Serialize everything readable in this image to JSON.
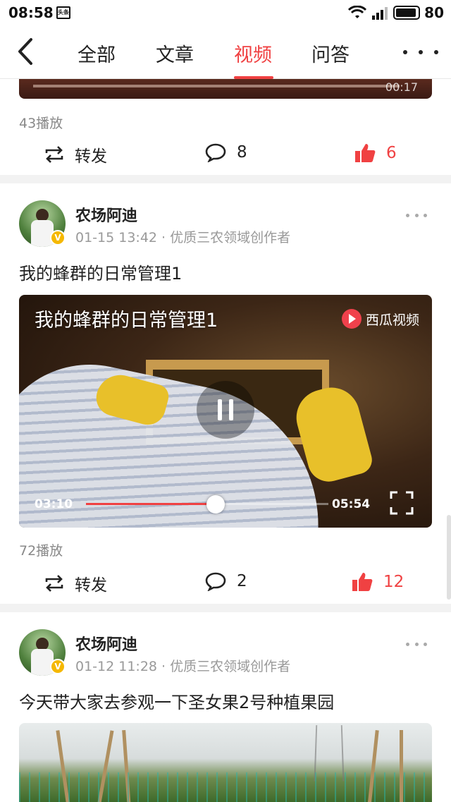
{
  "status_bar": {
    "time": "08:58",
    "notification_icon": "头条",
    "battery": "80"
  },
  "nav": {
    "tabs": [
      "全部",
      "文章",
      "视频",
      "问答"
    ],
    "active_tab": "视频"
  },
  "top_item": {
    "duration": "00:17",
    "plays": "43播放",
    "share_label": "转发",
    "comments": "8",
    "likes": "6"
  },
  "posts": [
    {
      "author": "农场阿迪",
      "meta": "01-15 13:42 · 优质三农领域创作者",
      "title": "我的蜂群的日常管理1",
      "video": {
        "overlay_title": "我的蜂群的日常管理1",
        "watermark": "西瓜视频",
        "current_time": "03:10",
        "duration": "05:54",
        "progress": 0.535
      },
      "plays": "72播放",
      "share_label": "转发",
      "comments": "2",
      "likes": "12"
    },
    {
      "author": "农场阿迪",
      "meta": "01-12 11:28 · 优质三农领域创作者",
      "title": "今天带大家去参观一下圣女果2号种植果园"
    }
  ],
  "colors": {
    "accent": "#f04142",
    "verified": "#f5b800"
  }
}
